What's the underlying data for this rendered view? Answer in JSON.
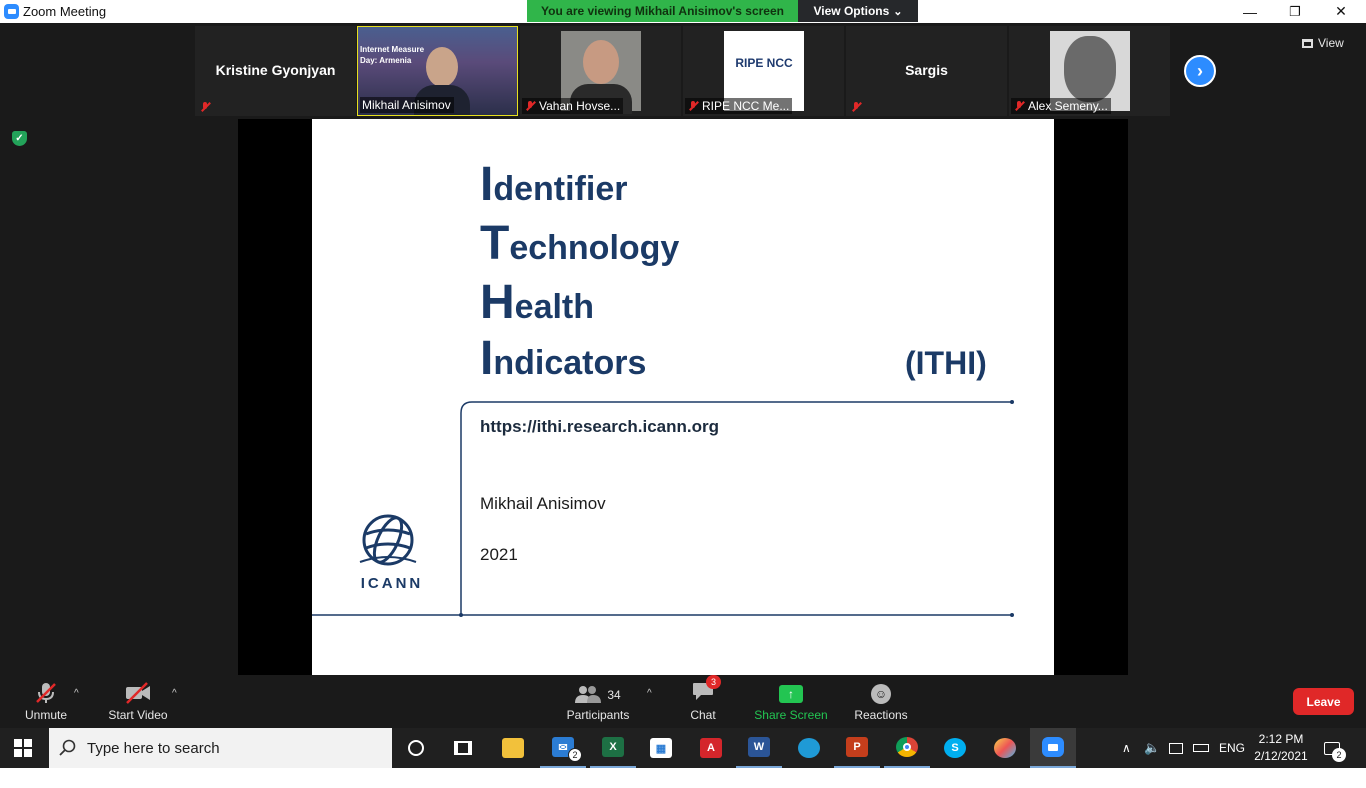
{
  "window": {
    "title": "Zoom Meeting",
    "minimize": "—",
    "maximize": "❐",
    "close": "✕"
  },
  "banner": {
    "viewing": "You are viewing Mikhail Anisimov's screen",
    "view_options": "View Options",
    "caret": "⌄"
  },
  "view_button": "View",
  "participants": [
    {
      "name": "Kristine Gyonjyan",
      "type": "name_only",
      "muted": true
    },
    {
      "name": "Mikhail Anisimov",
      "type": "video",
      "muted": false,
      "overlay_lines": [
        "Internet Measure",
        "Day: Armenia"
      ],
      "active": true
    },
    {
      "name": "Vahan Hovse...",
      "type": "video",
      "muted": true
    },
    {
      "name": "RIPE NCC Me...",
      "type": "logo",
      "muted": true,
      "logo_text": "RIPE NCC"
    },
    {
      "name": "Sargis",
      "type": "name_only",
      "muted": true
    },
    {
      "name": "Alex Semeny...",
      "type": "video",
      "muted": true
    }
  ],
  "slide": {
    "lines": [
      {
        "cap": "I",
        "rest": "dentifier"
      },
      {
        "cap": "T",
        "rest": "echnology"
      },
      {
        "cap": "H",
        "rest": "ealth"
      },
      {
        "cap": "I",
        "rest": "ndicators"
      }
    ],
    "abbrev": "(ITHI)",
    "url": "https://ithi.research.icann.org",
    "author": "Mikhail Anisimov",
    "year": "2021",
    "logo_text": "ICANN"
  },
  "toolbar": {
    "unmute": "Unmute",
    "start_video": "Start Video",
    "participants": "Participants",
    "participants_count": "34",
    "chat": "Chat",
    "chat_badge": "3",
    "share_screen": "Share Screen",
    "reactions": "Reactions",
    "leave": "Leave"
  },
  "taskbar": {
    "search_placeholder": "Type here to search",
    "mail_badge": "2",
    "lang": "ENG",
    "time": "2:12 PM",
    "date": "2/12/2021",
    "notif_badge": "2"
  },
  "colors": {
    "zoom_blue": "#2d8cff",
    "leave_red": "#e02828",
    "banner_green": "#30b54a",
    "share_green": "#23c552",
    "slide_navy": "#1b3a66"
  }
}
